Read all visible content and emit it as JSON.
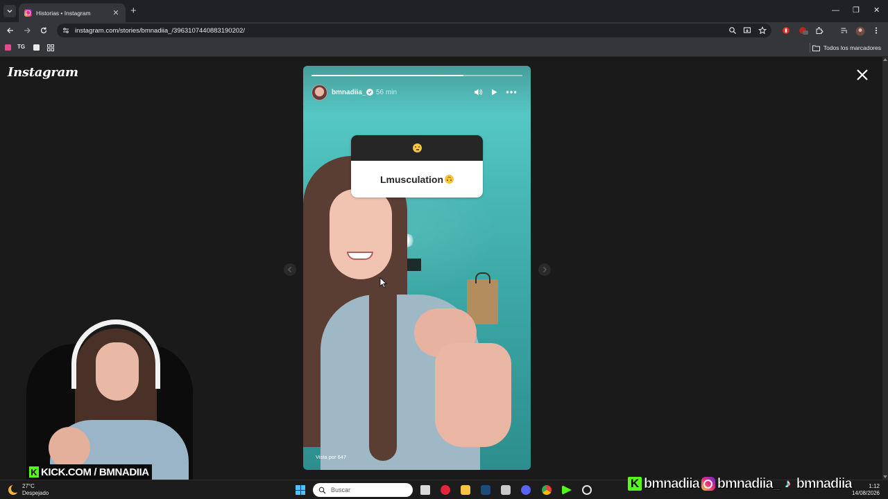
{
  "browser": {
    "tab_title": "Historias • Instagram",
    "tab_close": "✕",
    "new_tab": "+",
    "window_controls": {
      "minimize": "—",
      "restore": "❐",
      "close": "✕"
    },
    "url": "instagram.com/stories/bmnadiia_/3963107440883190202/",
    "bookmarks": [
      {
        "label": "",
        "icon": "pink-square-icon",
        "color": "#e8488a"
      },
      {
        "label": "TG",
        "icon": "tg-icon"
      },
      {
        "label": "",
        "icon": "white-square-icon",
        "color": "#e8e8e8"
      },
      {
        "label": "",
        "icon": "apps-grid-icon"
      }
    ],
    "all_bookmarks_label": "Todos los marcadores"
  },
  "instagram": {
    "logo_text": "Instagram",
    "story": {
      "username": "bmnadiia_",
      "time_ago": "56 min",
      "progress": 0.72,
      "question_emoji": "thinking-face-emoji",
      "answer_text": "Lmusculation",
      "answer_emoji": "upside-down-face-emoji",
      "views_label": "Vista por 647"
    }
  },
  "stream_overlay": {
    "kick_label": "KICK.COM / BMNADIIA",
    "kick_letter": "K",
    "socials": [
      {
        "platform": "kick",
        "icon": "kick-icon",
        "name": "bmnadiia"
      },
      {
        "platform": "instagram",
        "icon": "instagram-icon",
        "name": "bmnadiia_"
      },
      {
        "platform": "tiktok",
        "icon": "tiktok-icon",
        "name": "bmnadiia"
      }
    ]
  },
  "taskbar": {
    "weather_temp": "27°C",
    "weather_desc": "Despejado",
    "search_placeholder": "Buscar",
    "time": "1:12",
    "date": "14/08/2026"
  },
  "colors": {
    "kick_green": "#53fc18",
    "story_teal": "#49b9b5",
    "browser_dark": "#202124",
    "toolbar": "#35363a"
  }
}
